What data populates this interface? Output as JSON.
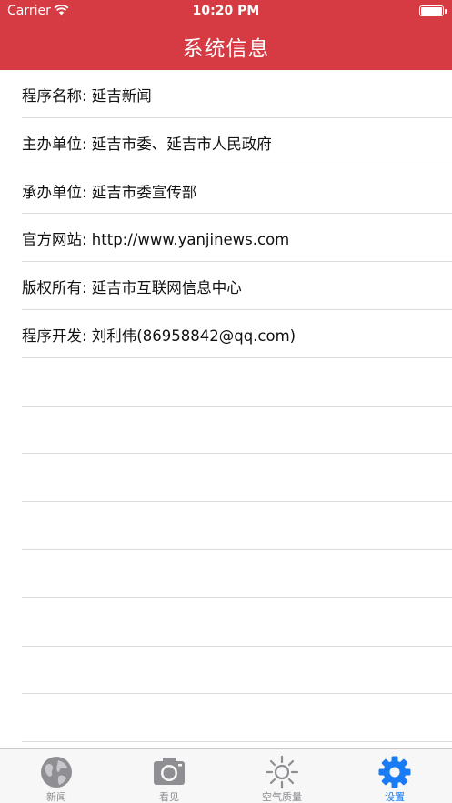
{
  "status_bar": {
    "carrier": "Carrier",
    "time": "10:20 PM"
  },
  "nav": {
    "title": "系统信息"
  },
  "info_rows": [
    "程序名称: 延吉新闻",
    "主办单位: 延吉市委、延吉市人民政府",
    "承办单位: 延吉市委宣传部",
    "官方网站: http://www.yanjinews.com",
    "版权所有: 延吉市互联网信息中心",
    "程序开发: 刘利伟(86958842@qq.com)"
  ],
  "empty_row_count": 8,
  "tabs": [
    {
      "label": "新闻",
      "icon": "globe-icon",
      "active": false
    },
    {
      "label": "看见",
      "icon": "camera-icon",
      "active": false
    },
    {
      "label": "空气质量",
      "icon": "sun-icon",
      "active": false
    },
    {
      "label": "设置",
      "icon": "gear-icon",
      "active": true
    }
  ],
  "colors": {
    "brand_red": "#d63a42",
    "active_tab": "#1a7cf5",
    "inactive_tab": "#8e8e93"
  }
}
